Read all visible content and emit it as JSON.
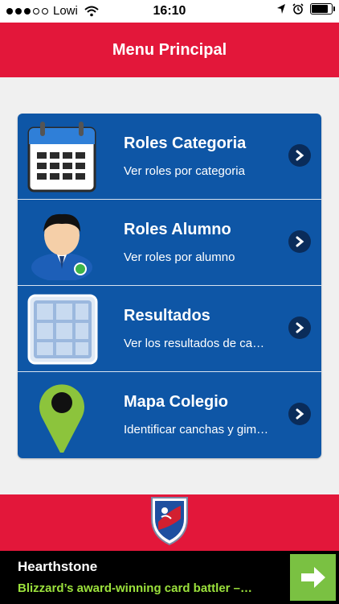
{
  "status_bar": {
    "carrier": "Lowi",
    "time": "16:10",
    "signal_bars_filled": 3,
    "signal_bars_total": 5,
    "battery_level": 0.9
  },
  "header": {
    "title": "Menu Principal"
  },
  "menu": {
    "items": [
      {
        "title": "Roles Categoria",
        "subtitle": "Ver roles por categoria",
        "icon": "calendar-icon"
      },
      {
        "title": "Roles Alumno",
        "subtitle": "Ver roles por alumno",
        "icon": "user-icon"
      },
      {
        "title": "Resultados",
        "subtitle": "Ver los resultados de ca…",
        "icon": "grid-icon"
      },
      {
        "title": "Mapa Colegio",
        "subtitle": "Identificar canchas y gim…",
        "icon": "map-pin-icon"
      }
    ]
  },
  "ad": {
    "title": "Hearthstone",
    "subtitle": "Blizzard’s award-winning card battler –…"
  },
  "colors": {
    "brand_red": "#e3173a",
    "menu_blue": "#0e56a6",
    "ad_green": "#7ac142"
  }
}
